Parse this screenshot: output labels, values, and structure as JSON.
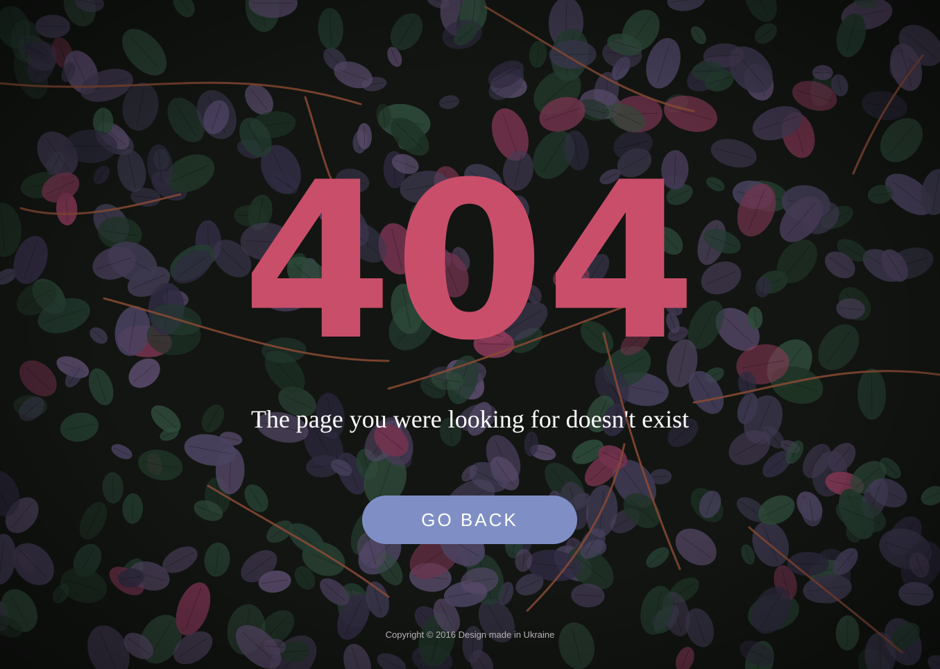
{
  "error_code": "404",
  "message": "The page you were looking for doesn't exist",
  "go_back_label": "GO BACK",
  "copyright": "Copyright © 2016 Design made in Ukraine",
  "colors": {
    "error_code": "#c94e6a",
    "button": "#7f8fc6",
    "background": "#151915"
  }
}
